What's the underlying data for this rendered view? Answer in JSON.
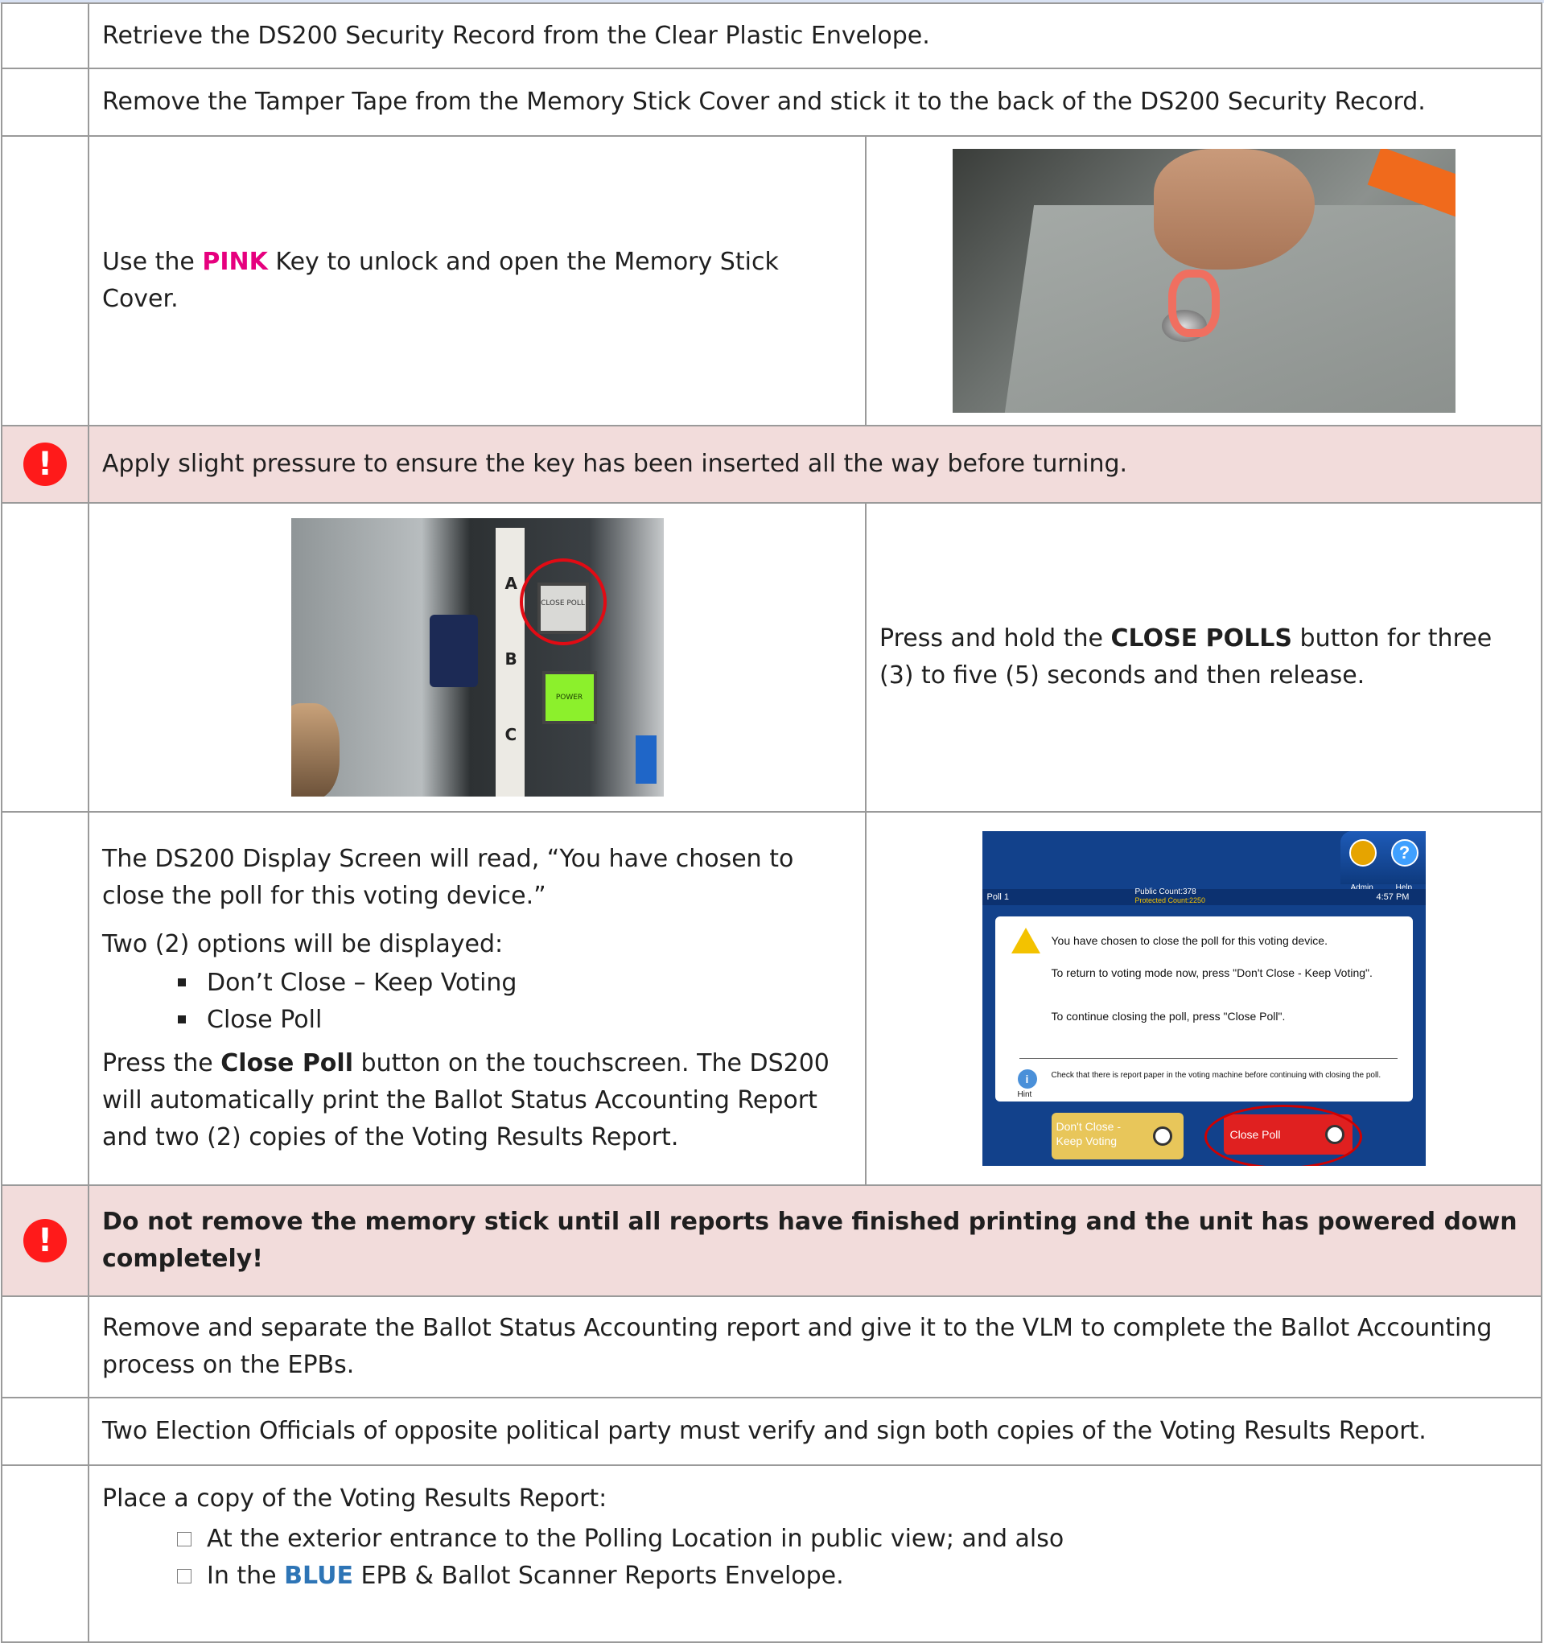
{
  "rows": {
    "r1": "Retrieve the DS200 Security Record from the Clear Plastic Envelope.",
    "r2": "Remove the Tamper Tape from the Memory Stick Cover and stick it to the back of the DS200 Security Record.",
    "r3": {
      "before": "Use the ",
      "highlight": "PINK",
      "after": " Key to unlock and open the Memory Stick Cover."
    },
    "warn1": {
      "icon": "!",
      "text": "Apply slight pressure to ensure the key has been inserted all the way before turning."
    },
    "r5": {
      "photo": {
        "letter_a": "A",
        "letter_b": "B",
        "letter_c": "C",
        "btn_close": "CLOSE POLL",
        "btn_power": "POWER"
      },
      "before": "Press and hold the ",
      "bold": "CLOSE POLLS",
      "after": " button for three (3) to five (5) seconds and then release."
    },
    "r6": {
      "p1": "The DS200 Display Screen will read, “You have chosen to close the poll for this voting device.”",
      "p2": "Two (2) options will be displayed:",
      "options": [
        "Don’t Close – Keep Voting",
        "Close Poll"
      ],
      "p3_before": "Press the ",
      "p3_bold": "Close Poll",
      "p3_after": " button on the touchscreen. The DS200 will automatically print the Ballot Status Accounting Report and two (2) copies of the Voting Results Report.",
      "screen": {
        "admin": "Admin",
        "help": "Help",
        "help_glyph": "?",
        "poll": "Poll 1",
        "public_count": "Public Count:378",
        "protected_count": "Protected Count:2250",
        "time": "4:57 PM",
        "msg1": "You have chosen to close the poll for this voting device.",
        "msg2": "To return to voting mode now, press \"Don't Close - Keep Voting\".",
        "msg3": "To continue closing the poll, press \"Close Poll\".",
        "hint": "Check that there is report paper in the voting machine before continuing with closing the poll.",
        "hint_label": "Hint",
        "info_glyph": "i",
        "btn_keep": "Don't Close - Keep Voting",
        "btn_close": "Close Poll"
      }
    },
    "warn2": {
      "icon": "!",
      "text": "Do not remove the memory stick until all reports have finished printing and the unit has powered down completely!"
    },
    "r8": "Remove and separate the Ballot Status Accounting report and give it to the VLM to complete the Ballot Accounting process on the EPBs.",
    "r9": "Two Election Officials of opposite political party must verify and sign both copies of the Voting Results Report.",
    "r10": {
      "intro": "Place a copy of the Voting Results Report:",
      "item1": "At the exterior entrance to the Polling Location in public view; and also",
      "item2_before": "In the ",
      "item2_highlight": "BLUE",
      "item2_after": " EPB & Ballot Scanner Reports Envelope."
    }
  },
  "colors": {
    "warning_row": "#f2dcdb",
    "alert_icon": "#ff1a1a",
    "pink": "#e6007e",
    "blue": "#2e75b6"
  }
}
